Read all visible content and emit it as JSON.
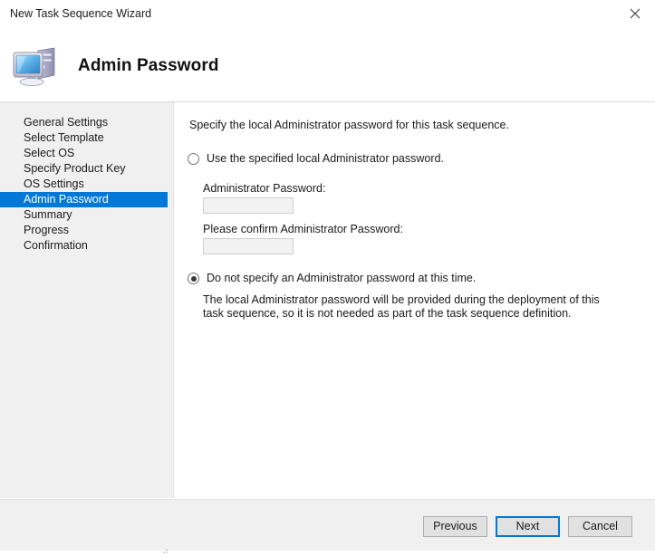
{
  "window": {
    "title": "New Task Sequence Wizard",
    "close_icon": "close-icon"
  },
  "header": {
    "title": "Admin Password",
    "icon": "computer-icon"
  },
  "sidebar": {
    "items": [
      {
        "label": "General Settings",
        "active": false
      },
      {
        "label": "Select Template",
        "active": false
      },
      {
        "label": "Select OS",
        "active": false
      },
      {
        "label": "Specify Product Key",
        "active": false
      },
      {
        "label": "OS Settings",
        "active": false
      },
      {
        "label": "Admin Password",
        "active": true
      },
      {
        "label": "Summary",
        "active": false
      },
      {
        "label": "Progress",
        "active": false
      },
      {
        "label": "Confirmation",
        "active": false
      }
    ],
    "active_color": "#0078d7"
  },
  "main": {
    "intro": "Specify the local Administrator password for this task sequence.",
    "option_specified": {
      "label": "Use the specified local Administrator password.",
      "selected": false,
      "password_label": "Administrator Password:",
      "password_value": "",
      "confirm_label": "Please confirm Administrator Password:",
      "confirm_value": ""
    },
    "option_not_specified": {
      "label": "Do not specify an Administrator password at this time.",
      "selected": true,
      "description": "The local Administrator password will be provided during the deployment of this task sequence, so it is not needed as part of the task sequence definition."
    }
  },
  "footer": {
    "previous_label": "Previous",
    "next_label": "Next",
    "cancel_label": "Cancel",
    "focus_color": "#0078d7"
  }
}
